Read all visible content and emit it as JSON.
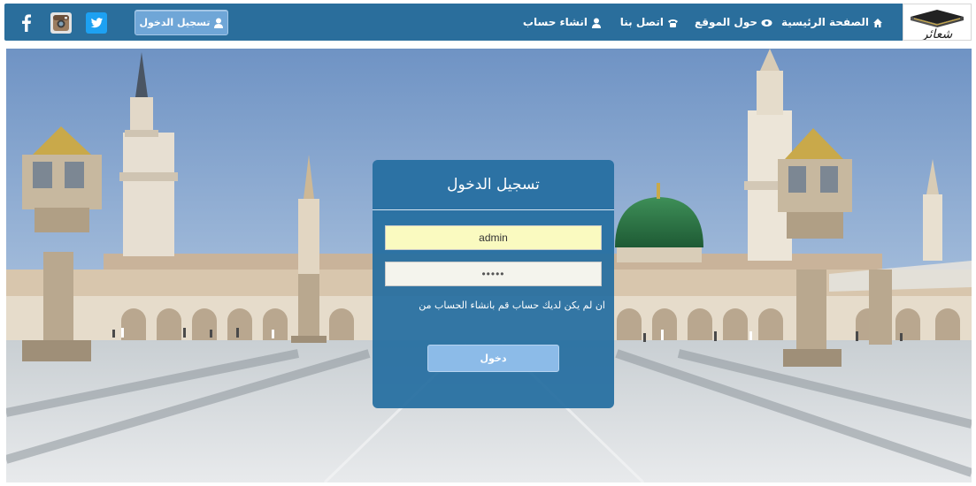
{
  "nav": {
    "logo_text": "شعائر",
    "items": [
      {
        "label": "الصفحة الرئيسية",
        "icon": "home-icon"
      },
      {
        "label": "حول الموقع",
        "icon": "eye-icon"
      },
      {
        "label": "اتصل بنا",
        "icon": "phone-icon"
      },
      {
        "label": "انشاء حساب",
        "icon": "user-icon"
      }
    ],
    "login_button": "تسجيل الدخول",
    "social": [
      "twitter-icon",
      "instagram-icon",
      "facebook-icon"
    ]
  },
  "login_form": {
    "title": "تسجيل الدخول",
    "username_value": "admin",
    "password_value": "•••••",
    "note": "ان لم يكن لديك حساب قم بانشاء الحساب من",
    "submit_label": "دخول"
  },
  "colors": {
    "navbar": "#2a6e9c",
    "card": "#256ea0",
    "username_field": "#fafac0",
    "button": "#8cbbe8"
  }
}
